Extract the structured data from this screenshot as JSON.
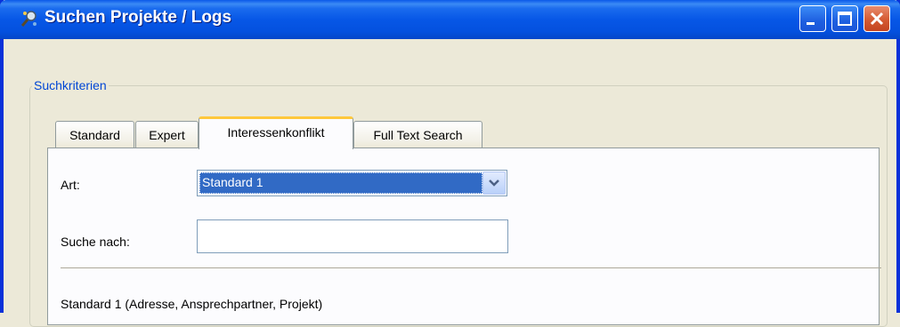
{
  "window": {
    "title": "Suchen Projekte / Logs",
    "icon": "search-app-icon"
  },
  "titlebar_buttons": {
    "minimize": "minimize-icon",
    "maximize": "maximize-icon",
    "close": "close-icon"
  },
  "group": {
    "legend": "Suchkriterien"
  },
  "tabs": [
    {
      "label": "Standard",
      "active": false
    },
    {
      "label": "Expert",
      "active": false
    },
    {
      "label": "Interessenkonflikt",
      "active": true
    },
    {
      "label": "Full Text Search",
      "active": false
    }
  ],
  "form": {
    "art_label": "Art:",
    "art_value": "Standard 1",
    "search_label": "Suche nach:",
    "search_value": "",
    "description": "Standard 1 (Adresse, Ansprechpartner, Projekt)"
  },
  "colors": {
    "titlebar": "#0757E6",
    "selection": "#316AC5",
    "legend_text": "#0046D5",
    "active_tab_accent": "#FFC83C"
  }
}
